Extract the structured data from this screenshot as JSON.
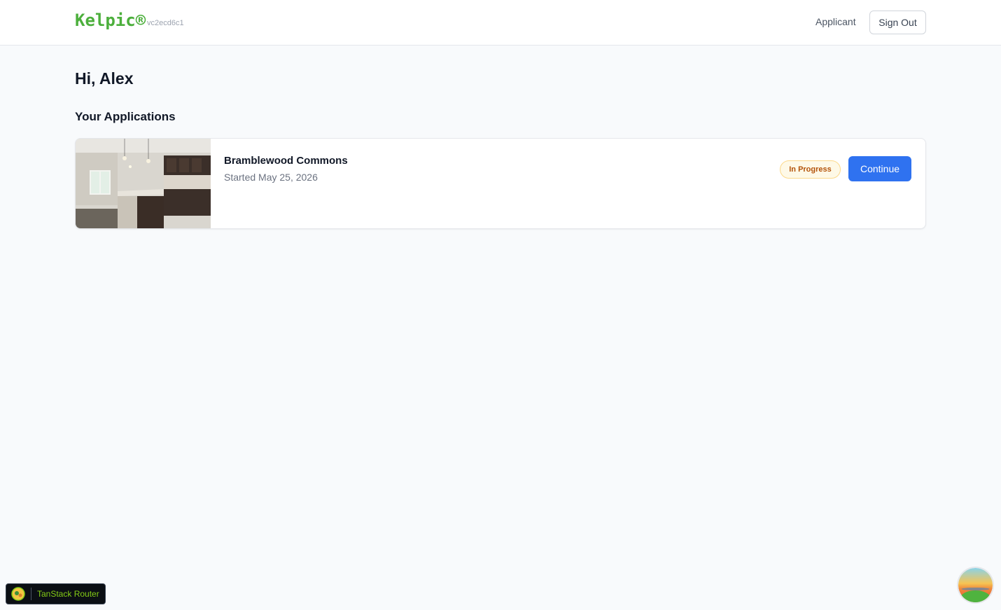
{
  "header": {
    "brand": "Kelpic®",
    "version": "vc2ecd6c1",
    "role": "Applicant",
    "sign_out_label": "Sign Out"
  },
  "main": {
    "greeting": "Hi, Alex",
    "section_title": "Your Applications",
    "applications": [
      {
        "property_name": "Bramblewood Commons",
        "started": "Started May 25, 2026",
        "status": "In Progress",
        "action_label": "Continue"
      }
    ]
  },
  "devtools": {
    "router_label": "TanStack Router"
  },
  "colors": {
    "brand": "#4caf3c",
    "primary": "#2f72f0",
    "badge_bg": "#fef9e7",
    "badge_text": "#b45309"
  }
}
